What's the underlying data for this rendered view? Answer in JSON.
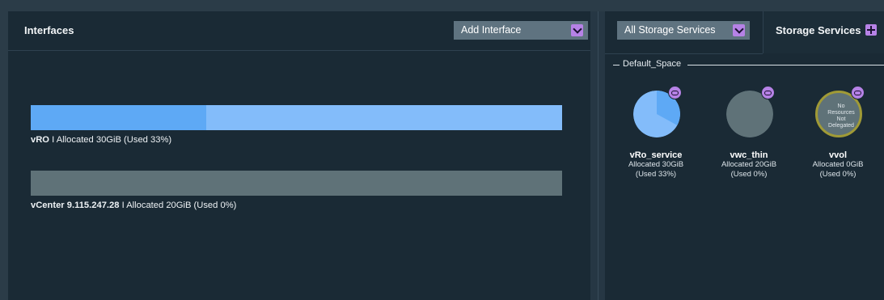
{
  "interfaces_panel": {
    "title": "Interfaces",
    "add_interface_label": "Add Interface",
    "bars": [
      {
        "name": "vRO",
        "detail": "I Allocated 30GiB (Used 33%)",
        "used_fraction": 0.33,
        "used_color": "#5ea9f5",
        "free_color": "#83bcfa"
      },
      {
        "name": "vCenter 9.115.247.28",
        "detail": "I Allocated 20GiB (Used 0%)",
        "used_fraction": 0.0,
        "used_color": "#5ea9f5",
        "free_color": "#5f7278"
      }
    ]
  },
  "storage_panel": {
    "filter_label": "All Storage Services",
    "tab_label": "Storage Services",
    "add_icon": "plus-icon",
    "space_name": "Default_Space",
    "services": [
      {
        "name": "vRo_service",
        "allocated": "Allocated 30GiB",
        "used": "(Used 33%)",
        "used_fraction": 0.33,
        "icon": "link-icon",
        "fill_color": "#83bcfa",
        "used_color": "#5ea9f5"
      },
      {
        "name": "vwc_thin",
        "allocated": "Allocated 20GiB",
        "used": "(Used 0%)",
        "used_fraction": 0.0,
        "icon": "link-icon",
        "fill_color": "#5f7278",
        "used_color": "#5ea9f5"
      },
      {
        "name": "vvol",
        "allocated": "Allocated 0GiB",
        "used": "(Used 0%)",
        "empty_text_lines": [
          "No",
          "Resources",
          "Not",
          "Delegated"
        ],
        "icon": "link-icon",
        "fill_color": "#5f7278",
        "ring_color": "#a09a36"
      }
    ]
  },
  "accent_color": "#b682e6"
}
